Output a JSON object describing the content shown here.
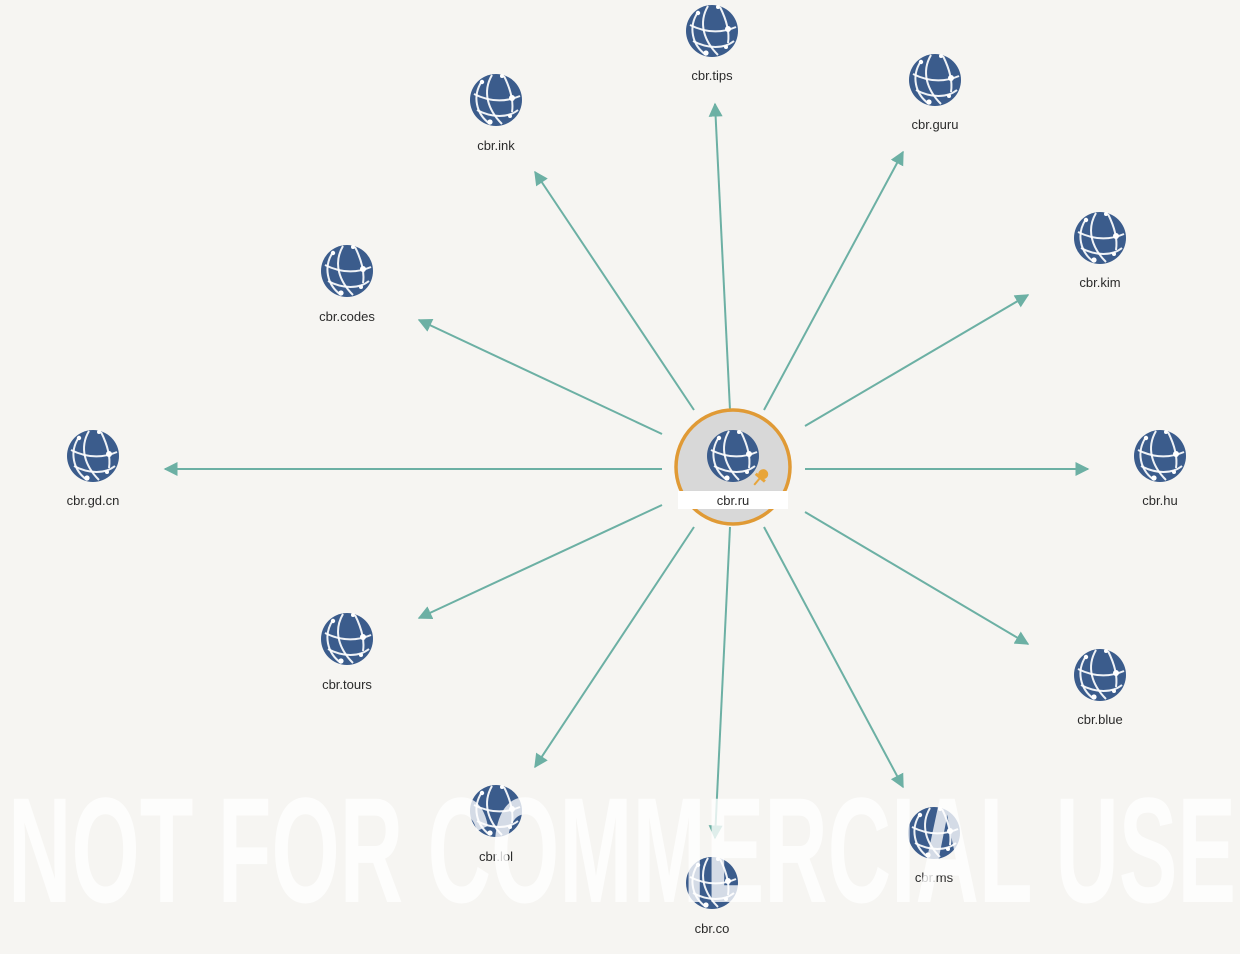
{
  "graph": {
    "center": {
      "label": "cbr.ru",
      "icon": "globe-icon",
      "pin_icon": "pin-icon",
      "ring_color": "#e09a35",
      "highlight_fill": "#d8d8d8"
    },
    "nodes": [
      {
        "id": "tips",
        "label": "cbr.tips",
        "icon": "globe-icon"
      },
      {
        "id": "guru",
        "label": "cbr.guru",
        "icon": "globe-icon"
      },
      {
        "id": "kim",
        "label": "cbr.kim",
        "icon": "globe-icon"
      },
      {
        "id": "hu",
        "label": "cbr.hu",
        "icon": "globe-icon"
      },
      {
        "id": "blue",
        "label": "cbr.blue",
        "icon": "globe-icon"
      },
      {
        "id": "ms",
        "label": "cbr.ms",
        "icon": "globe-icon"
      },
      {
        "id": "co",
        "label": "cbr.co",
        "icon": "globe-icon"
      },
      {
        "id": "lol",
        "label": "cbr.lol",
        "icon": "globe-icon"
      },
      {
        "id": "tours",
        "label": "cbr.tours",
        "icon": "globe-icon"
      },
      {
        "id": "gdcn",
        "label": "cbr.gd.cn",
        "icon": "globe-icon"
      },
      {
        "id": "codes",
        "label": "cbr.codes",
        "icon": "globe-icon"
      },
      {
        "id": "ink",
        "label": "cbr.ink",
        "icon": "globe-icon"
      }
    ],
    "edge_color": "#6cb0a4",
    "globe_color": "#3b5c8c"
  },
  "watermark": {
    "text": "NOT FOR COMMERCIAL USE"
  }
}
